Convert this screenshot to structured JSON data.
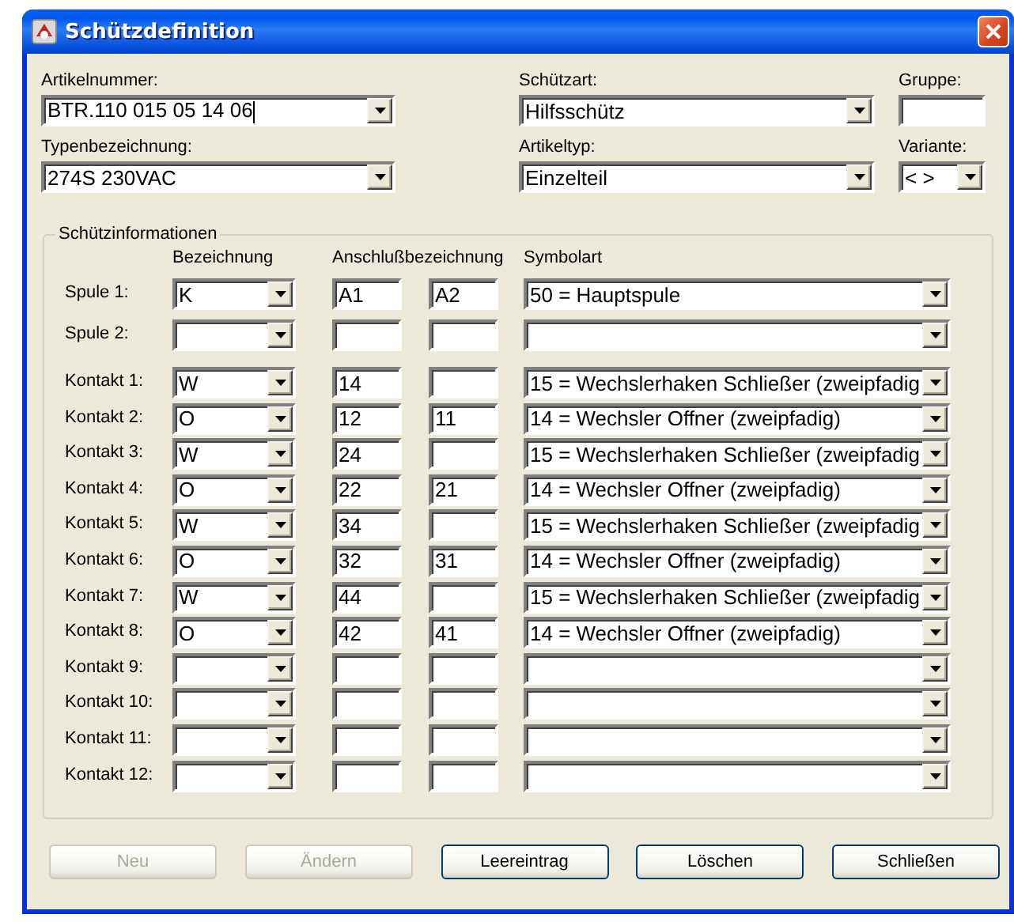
{
  "window": {
    "title": "Schützdefinition"
  },
  "header": {
    "article_number": {
      "label": "Artikelnummer:",
      "value": "BTR.110 015 05 14 06",
      "focused": true
    },
    "type_designation": {
      "label": "Typenbezeichnung:",
      "value": "274S 230VAC"
    },
    "contactor_type": {
      "label": "Schützart:",
      "value": "Hilfsschütz"
    },
    "article_type": {
      "label": "Artikeltyp:",
      "value": "Einzelteil"
    },
    "group": {
      "label": "Gruppe:"
    },
    "variant": {
      "label": "Variante:",
      "value": "< >"
    }
  },
  "info": {
    "title": "Schützinformationen",
    "columns": [
      "Bezeichnung",
      "Anschlußbezeichnung",
      "Symbolart"
    ],
    "coils": [
      {
        "label": "Spule 1:",
        "designation": "K",
        "terminal_1": "A1",
        "terminal_2": "A2",
        "symbol_type": "50 = Hauptspule"
      },
      {
        "label": "Spule 2:"
      }
    ],
    "contacts": [
      {
        "label": "Kontakt 1:",
        "designation": "W",
        "terminal_1": "14",
        "symbol_type": "15 = Wechslerhaken Schließer (zweipfadig"
      },
      {
        "label": "Kontakt 2:",
        "designation": "O",
        "terminal_1": "12",
        "terminal_2": "11",
        "symbol_type": "14 = Wechsler Offner (zweipfadig)"
      },
      {
        "label": "Kontakt 3:",
        "designation": "W",
        "terminal_1": "24",
        "symbol_type": "15 = Wechslerhaken Schließer (zweipfadig"
      },
      {
        "label": "Kontakt 4:",
        "designation": "O",
        "terminal_1": "22",
        "terminal_2": "21",
        "symbol_type": "14 = Wechsler Offner (zweipfadig)"
      },
      {
        "label": "Kontakt 5:",
        "designation": "W",
        "terminal_1": "34",
        "symbol_type": "15 = Wechslerhaken Schließer (zweipfadig"
      },
      {
        "label": "Kontakt 6:",
        "designation": "O",
        "terminal_1": "32",
        "terminal_2": "31",
        "symbol_type": "14 = Wechsler Offner (zweipfadig)"
      },
      {
        "label": "Kontakt 7:",
        "designation": "W",
        "terminal_1": "44",
        "symbol_type": "15 = Wechslerhaken Schließer (zweipfadig"
      },
      {
        "label": "Kontakt 8:",
        "designation": "O",
        "terminal_1": "42",
        "terminal_2": "41",
        "symbol_type": "14 = Wechsler Offner (zweipfadig)"
      },
      {
        "label": "Kontakt 9:"
      },
      {
        "label": "Kontakt 10:"
      },
      {
        "label": "Kontakt 11:"
      },
      {
        "label": "Kontakt 12:"
      }
    ]
  },
  "buttons": [
    {
      "label": "Neu",
      "disabled": true
    },
    {
      "label": "Ändern",
      "disabled": true
    },
    {
      "label": "Leereintrag",
      "disabled": false
    },
    {
      "label": "Löschen",
      "disabled": false
    },
    {
      "label": "Schließen",
      "disabled": false
    }
  ]
}
